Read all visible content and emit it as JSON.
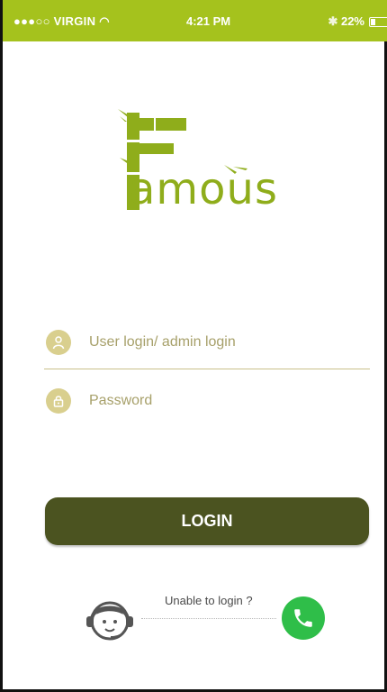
{
  "status_bar": {
    "carrier": "●●●○○ VIRGIN",
    "time": "4:21 PM",
    "battery": "22%"
  },
  "logo": {
    "text": "amous"
  },
  "login_form": {
    "username_placeholder": "User login/ admin login",
    "password_placeholder": "Password",
    "login_label": "LOGIN"
  },
  "help": {
    "text": "Unable to login ?"
  },
  "colors": {
    "accent": "#a5c21d",
    "button": "#4b5320",
    "icon_bg": "#d9cf8e",
    "call": "#2fbe49"
  }
}
